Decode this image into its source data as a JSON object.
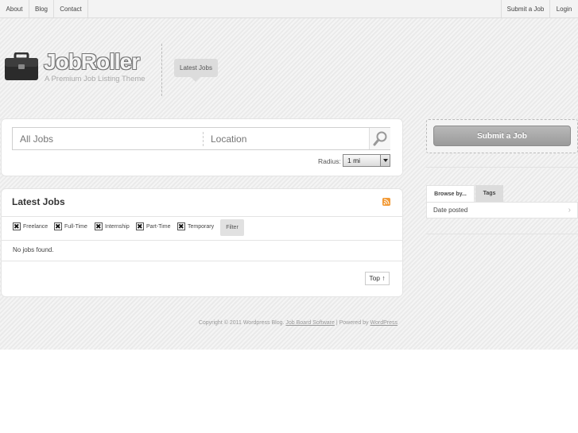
{
  "nav": {
    "left": [
      {
        "label": "About"
      },
      {
        "label": "Blog"
      },
      {
        "label": "Contact"
      }
    ],
    "right": [
      {
        "label": "Submit a Job"
      },
      {
        "label": "Login"
      }
    ]
  },
  "logo": {
    "title": "JobRoller",
    "tagline": "A Premium Job Listing Theme",
    "icon": "briefcase-icon"
  },
  "header": {
    "tab_label": "Latest Jobs"
  },
  "search": {
    "keywords_placeholder": "All Jobs",
    "location_placeholder": "Location",
    "button_icon": "magnifier-icon",
    "radius_label": "Radius:",
    "radius_value": "1 mi"
  },
  "jobs": {
    "title": "Latest Jobs",
    "rss_icon": "rss-icon",
    "filters": [
      {
        "label": "Freelance",
        "checked": true
      },
      {
        "label": "Full-Time",
        "checked": true
      },
      {
        "label": "Internship",
        "checked": true
      },
      {
        "label": "Part-Time",
        "checked": true
      },
      {
        "label": "Temporary",
        "checked": true
      }
    ],
    "filter_button": "Filter",
    "empty_message": "No jobs found.",
    "top_button": "Top ↑"
  },
  "footer": {
    "prefix": "Copyright © 2011 Wordpress Blog. ",
    "link1": "Job Board Software",
    "middle": " | Powered by ",
    "link2": "WordPress"
  },
  "sidebar": {
    "submit_button": "Submit a Job",
    "tabs": [
      {
        "label": "Browse by...",
        "active": true
      },
      {
        "label": "Tags",
        "active": false
      }
    ],
    "browse_items": [
      {
        "label": "Date posted"
      }
    ]
  },
  "colors": {
    "background": "#efefef",
    "panel": "#ffffff",
    "rss": "#f29a36",
    "submit_button": "#a8a8a8"
  }
}
